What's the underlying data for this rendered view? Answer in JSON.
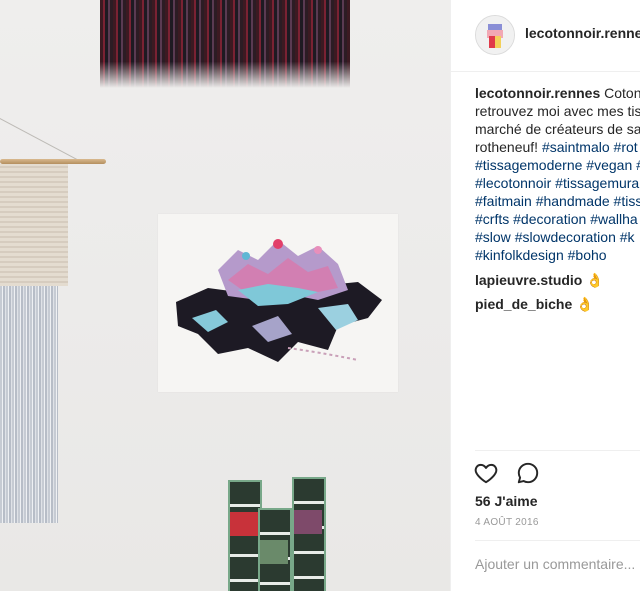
{
  "post": {
    "username": "lecotonnoir.rennes",
    "caption_lines": [
      {
        "parts": [
          {
            "t": "lecotonnoir.rennes",
            "k": "user"
          },
          {
            "t": " Coton",
            "k": "text"
          }
        ]
      },
      {
        "parts": [
          {
            "t": "retrouvez moi avec mes tis",
            "k": "text"
          }
        ]
      },
      {
        "parts": [
          {
            "t": "marché de créateurs de sa",
            "k": "text"
          }
        ]
      },
      {
        "parts": [
          {
            "t": "rotheneuf! ",
            "k": "text"
          },
          {
            "t": "#saintmalo",
            "k": "tag"
          },
          {
            "t": " ",
            "k": "text"
          },
          {
            "t": "#rot",
            "k": "tag"
          }
        ]
      },
      {
        "parts": [
          {
            "t": "#tissagemoderne",
            "k": "tag"
          },
          {
            "t": " ",
            "k": "text"
          },
          {
            "t": "#vegan",
            "k": "tag"
          },
          {
            "t": " #",
            "k": "tag"
          }
        ]
      },
      {
        "parts": [
          {
            "t": "#lecotonnoir",
            "k": "tag"
          },
          {
            "t": " ",
            "k": "text"
          },
          {
            "t": "#tissagemura",
            "k": "tag"
          }
        ]
      },
      {
        "parts": [
          {
            "t": "#faitmain",
            "k": "tag"
          },
          {
            "t": " ",
            "k": "text"
          },
          {
            "t": "#handmade",
            "k": "tag"
          },
          {
            "t": " ",
            "k": "text"
          },
          {
            "t": "#tiss",
            "k": "tag"
          }
        ]
      },
      {
        "parts": [
          {
            "t": "#crfts",
            "k": "tag"
          },
          {
            "t": " ",
            "k": "text"
          },
          {
            "t": "#decoration",
            "k": "tag"
          },
          {
            "t": " ",
            "k": "text"
          },
          {
            "t": "#wallha",
            "k": "tag"
          }
        ]
      },
      {
        "parts": [
          {
            "t": "#slow",
            "k": "tag"
          },
          {
            "t": " ",
            "k": "text"
          },
          {
            "t": "#slowdecoration",
            "k": "tag"
          },
          {
            "t": " ",
            "k": "text"
          },
          {
            "t": "#k",
            "k": "tag"
          }
        ]
      },
      {
        "parts": [
          {
            "t": "#kinfolkdesign",
            "k": "tag"
          },
          {
            "t": " ",
            "k": "text"
          },
          {
            "t": "#boho",
            "k": "tag"
          }
        ]
      }
    ],
    "comments": [
      {
        "user": "lapieuvre.studio",
        "emoji": "👌"
      },
      {
        "user": "pied_de_biche",
        "emoji": "👌"
      }
    ],
    "likes": "56 J'aime",
    "date": "4 août 2016",
    "comment_placeholder": "Ajouter un commentaire..."
  },
  "icons": {
    "like": "heart-outline-icon",
    "comment": "speech-bubble-icon",
    "ok_hand": "ok-hand-emoji"
  },
  "colors": {
    "text": "#262626",
    "hashtag": "#003569",
    "muted": "#999999",
    "border": "#efefef"
  }
}
